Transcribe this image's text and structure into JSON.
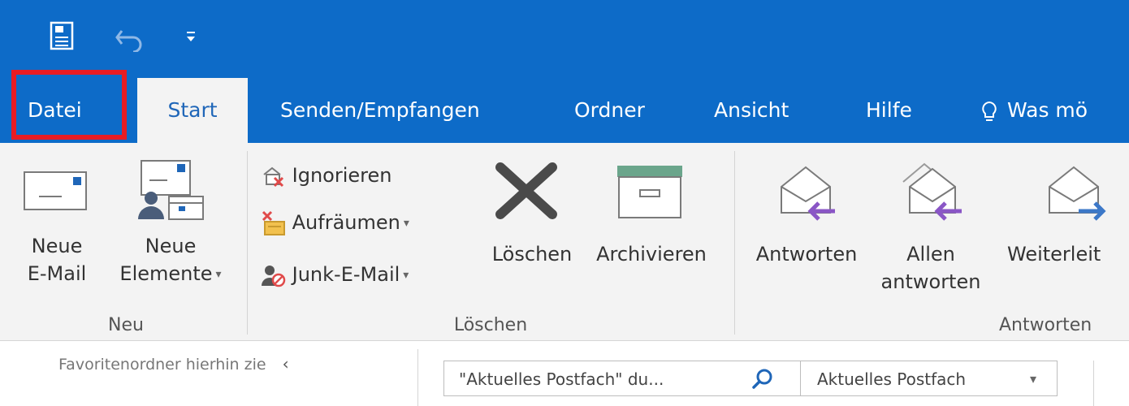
{
  "tabs": {
    "file": "Datei",
    "home": "Start",
    "send_receive": "Senden/Empfangen",
    "folder": "Ordner",
    "view": "Ansicht",
    "help": "Hilfe",
    "tell_me": "Was mö"
  },
  "ribbon": {
    "new_group": {
      "new_email": [
        "Neue",
        "E-Mail"
      ],
      "new_items": [
        "Neue",
        "Elemente"
      ],
      "label": "Neu"
    },
    "delete_group": {
      "ignore": "Ignorieren",
      "clean_up": "Aufräumen",
      "junk": "Junk-E-Mail",
      "delete": "Löschen",
      "archive": "Archivieren",
      "label": "Löschen"
    },
    "respond_group": {
      "reply": "Antworten",
      "reply_all": [
        "Allen",
        "antworten"
      ],
      "forward": "Weiterleit",
      "label": "Antworten"
    }
  },
  "pane": {
    "favorites_hint": "Favoritenordner hierhin zie",
    "search_placeholder": "\"Aktuelles Postfach\" du...",
    "search_scope": "Aktuelles Postfach"
  },
  "colors": {
    "title_bar": "#0d6bc8",
    "ribbon_bg": "#f3f3f3",
    "highlight": "#e81c23",
    "reply_arrow": "#8a56c6",
    "forward_arrow": "#3c78c8"
  },
  "icons": [
    "save-icon",
    "undo-icon",
    "customize-qat-icon",
    "lightbulb-icon",
    "new-email-icon",
    "new-items-icon",
    "ignore-icon",
    "clean-up-icon",
    "junk-icon",
    "delete-icon",
    "archive-icon",
    "reply-icon",
    "reply-all-icon",
    "forward-icon",
    "collapse-chevron-icon",
    "search-icon",
    "dropdown-caret-icon"
  ]
}
